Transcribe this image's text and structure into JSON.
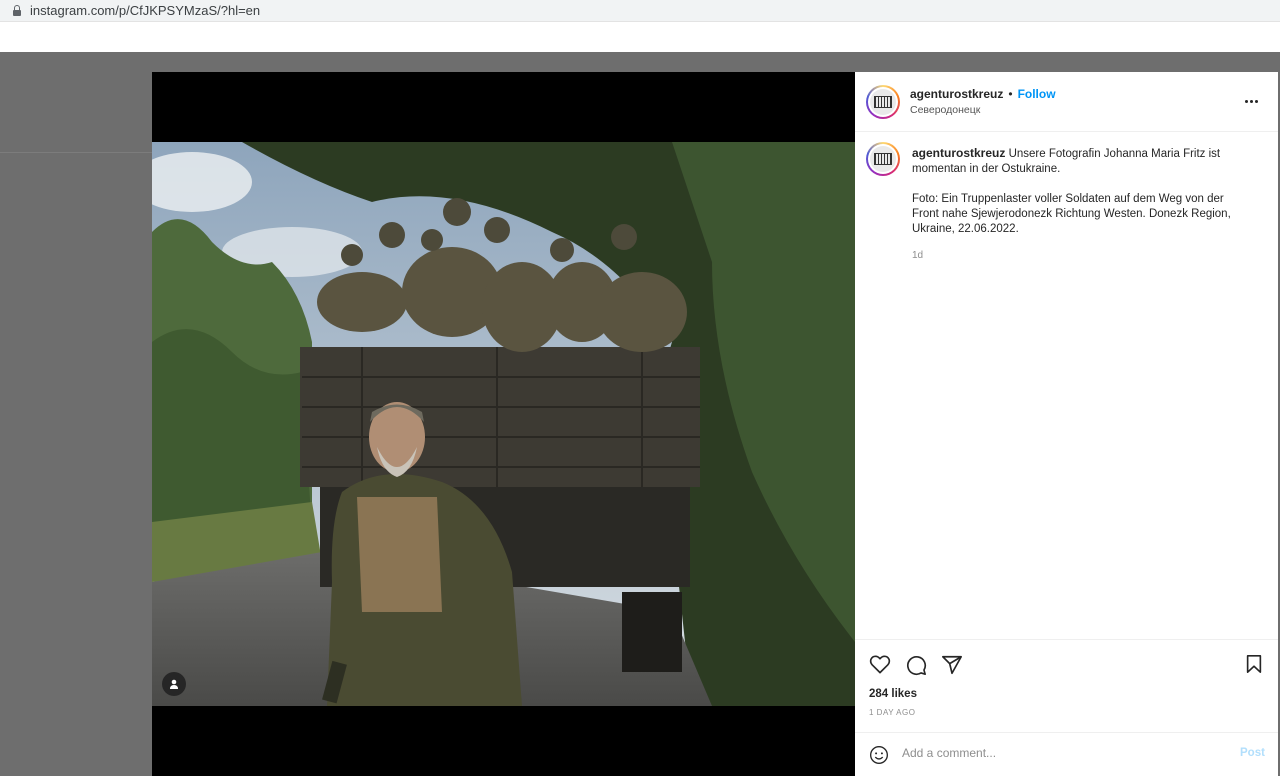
{
  "browser": {
    "url": "instagram.com/p/CfJKPSYMzaS/?hl=en"
  },
  "post": {
    "username": "agenturostkreuz",
    "follow_label": "Follow",
    "separator": "•",
    "location": "Северодонецк",
    "caption_line1": "Unsere Fotografin Johanna Maria Fritz ist momentan in der Ostukraine.",
    "caption_line2": "Foto: Ein Truppenlaster voller Soldaten auf dem Weg von der Front nahe Sjewjerodonezk Richtung Westen. Donezk Region, Ukraine, 22.06.2022.",
    "time_ago": "1d",
    "likes": "284 likes",
    "date": "1 DAY AGO",
    "comment_placeholder": "Add a comment...",
    "post_label": "Post"
  },
  "icons": [
    "lock-icon",
    "more-icon",
    "heart-icon",
    "comment-icon",
    "share-icon",
    "bookmark-icon",
    "emoji-icon",
    "user-tag-icon"
  ]
}
